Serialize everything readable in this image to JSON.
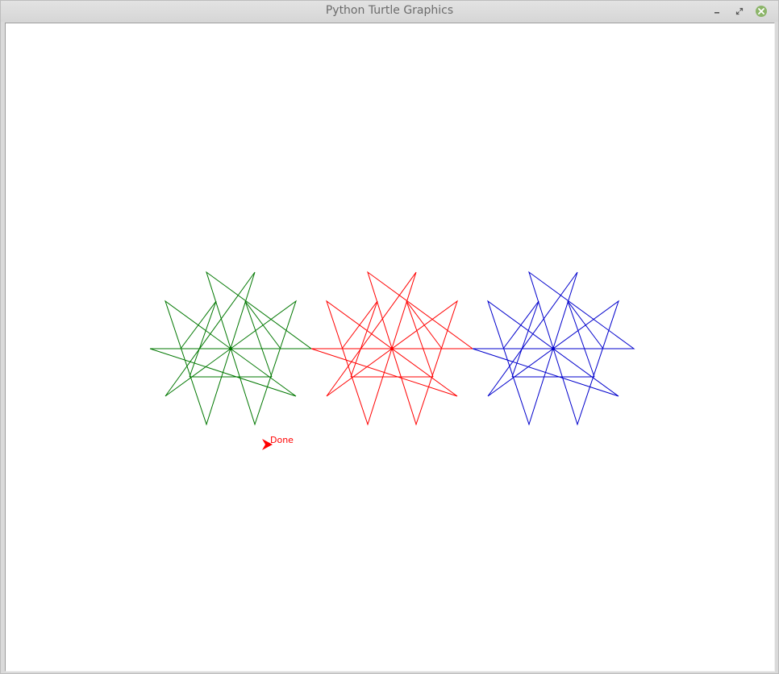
{
  "window": {
    "title": "Python Turtle Graphics"
  },
  "canvas": {
    "background": "#ffffff",
    "done_text": "Done",
    "done_color": "#ff0000",
    "cursor_color": "#ff0000"
  },
  "drawings": [
    {
      "name": "green-star-figure",
      "color": "#007700"
    },
    {
      "name": "red-star-figure",
      "color": "#ff0000"
    },
    {
      "name": "blue-star-figure",
      "color": "#0000cc"
    }
  ],
  "icons": {
    "minimize": "minimize-icon",
    "maximize": "maximize-icon",
    "close": "close-icon"
  }
}
